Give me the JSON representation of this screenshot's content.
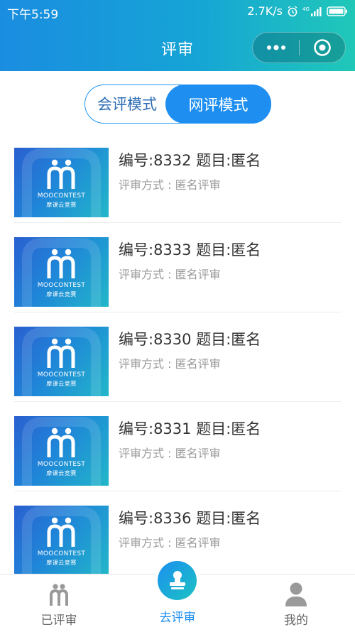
{
  "status_bar": {
    "time": "下午5:59",
    "net_speed": "2.7K/s",
    "network": "4G"
  },
  "header": {
    "title": "评审"
  },
  "mode_toggle": {
    "meeting_label": "会评模式",
    "online_label": "网评模式",
    "selected": "网评模式"
  },
  "thumb": {
    "brand_en": "MOOCONTEST",
    "brand_cn": "摩课云竞赛"
  },
  "items": [
    {
      "title": "编号:8332 题目:匿名",
      "method": "评审方式 : 匿名评审"
    },
    {
      "title": "编号:8333 题目:匿名",
      "method": "评审方式 : 匿名评审"
    },
    {
      "title": "编号:8330 题目:匿名",
      "method": "评审方式 : 匿名评审"
    },
    {
      "title": "编号:8331 题目:匿名",
      "method": "评审方式 : 匿名评审"
    },
    {
      "title": "编号:8336 题目:匿名",
      "method": "评审方式 : 匿名评审"
    }
  ],
  "bottom_nav": {
    "tabs": [
      {
        "label": "已评审",
        "icon": "reviewed-icon"
      },
      {
        "label": "去评审",
        "icon": "review-stamp-icon",
        "active": true
      },
      {
        "label": "我的",
        "icon": "user-icon"
      }
    ]
  },
  "colors": {
    "primary": "#1e8ff0",
    "header_start": "#1a8de0",
    "header_end": "#20c8b8",
    "subtext": "#999999"
  }
}
